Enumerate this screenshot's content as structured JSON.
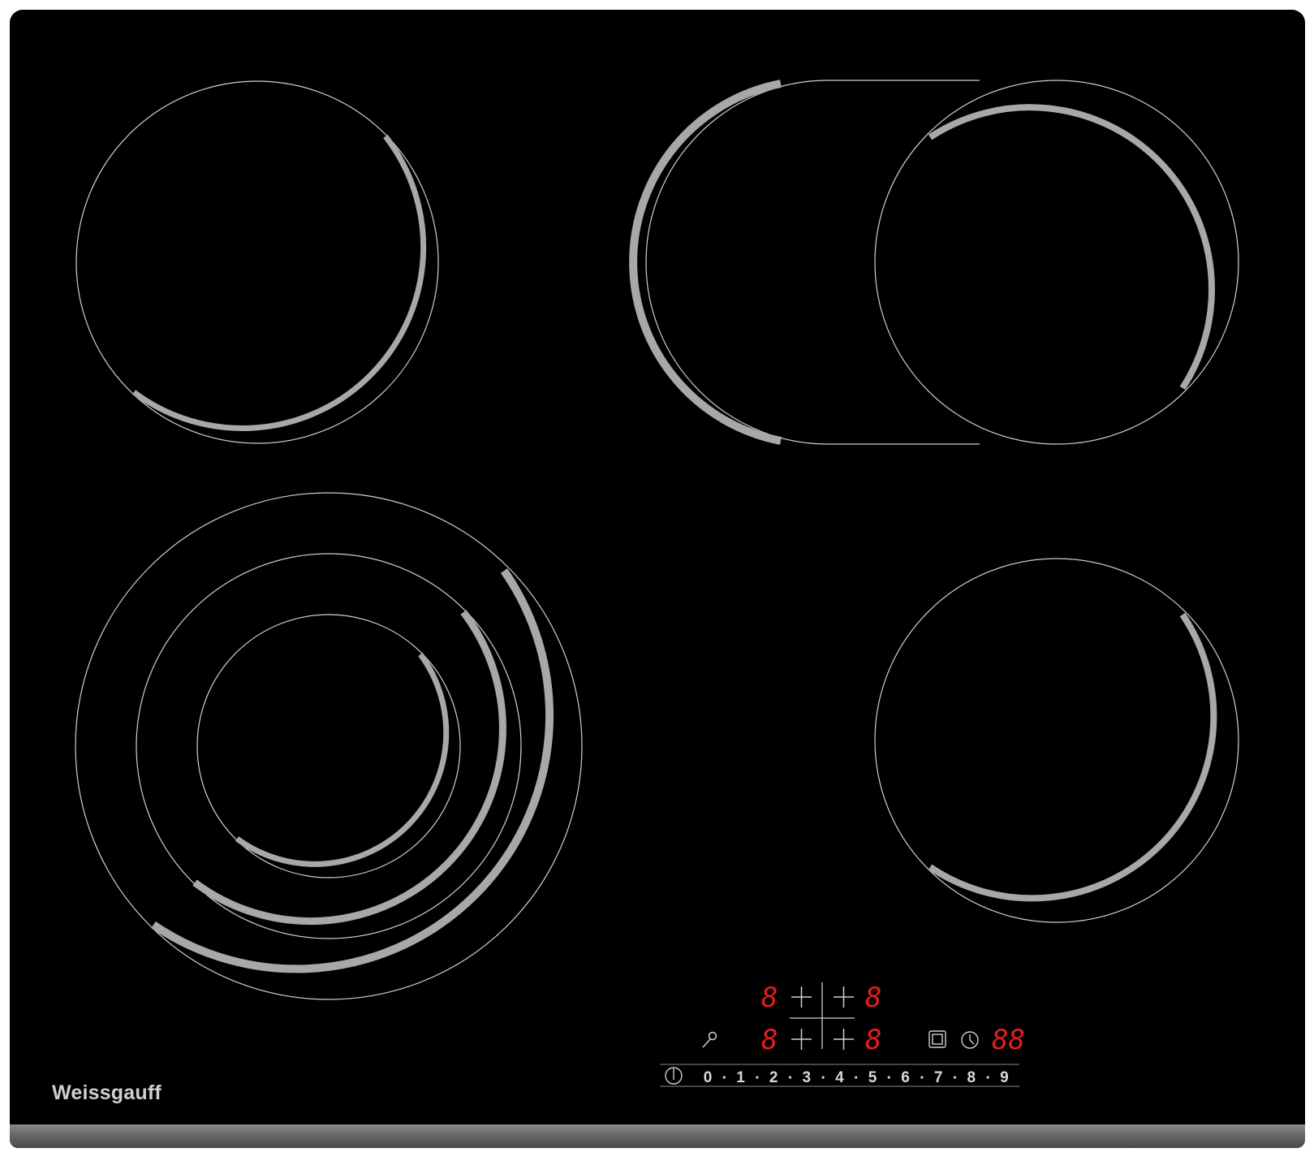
{
  "brand": "Weissgauff",
  "colors": {
    "glass": "#000000",
    "ring_line": "#cfcfcf",
    "ring_arc": "#9a9a9a",
    "display_red": "#e21d1d",
    "label": "#d8d8d8"
  },
  "controls": {
    "zone_digits": [
      "8",
      "8",
      "8",
      "8"
    ],
    "timer_digits": "88",
    "power_scale": [
      "0",
      "1",
      "2",
      "3",
      "4",
      "5",
      "6",
      "7",
      "8",
      "9"
    ],
    "icons": [
      "power-icon",
      "key-lock-icon",
      "plus-icon",
      "expand-zone-icon",
      "clock-icon"
    ]
  }
}
